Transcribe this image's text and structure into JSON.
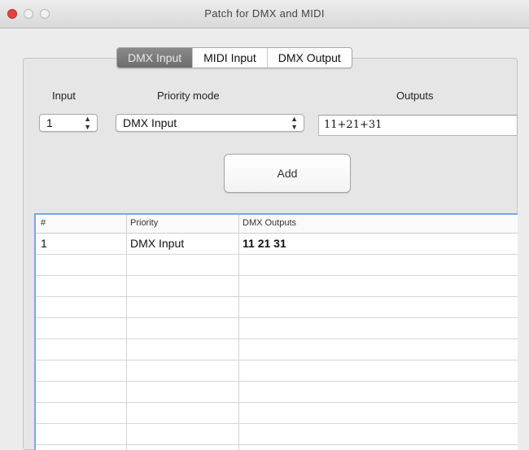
{
  "window": {
    "title": "Patch for DMX and MIDI"
  },
  "tabs": [
    {
      "label": "DMX Input",
      "active": true
    },
    {
      "label": "MIDI Input",
      "active": false
    },
    {
      "label": "DMX Output",
      "active": false
    }
  ],
  "form": {
    "input_label": "Input",
    "priority_label": "Priority mode",
    "outputs_label": "Outputs",
    "input_value": "1",
    "priority_value": "DMX Input",
    "outputs_value": "11+21+31",
    "add_label": "Add"
  },
  "table": {
    "columns": [
      "#",
      "Priority",
      "DMX Outputs"
    ],
    "rows": [
      {
        "index": "1",
        "priority": "DMX Input",
        "outputs": "11 21 31"
      }
    ]
  },
  "colors": {
    "close": "#e0443e",
    "selection_border": "#7aa7e3",
    "active_tab": "#7a7a7a"
  }
}
